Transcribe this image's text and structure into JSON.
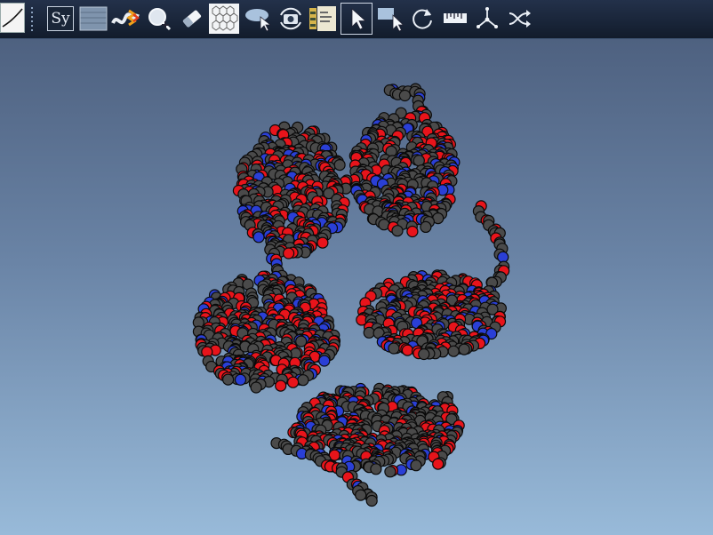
{
  "toolbar": {
    "symbol_button_label": "Sy",
    "tools": [
      {
        "name": "thumbnail-icon"
      },
      {
        "name": "symbol-button"
      },
      {
        "name": "surface-icon"
      },
      {
        "name": "ribbon-icon"
      },
      {
        "name": "zoom-in-icon"
      },
      {
        "name": "eraser-icon"
      },
      {
        "name": "hexagon-grid-icon"
      },
      {
        "name": "cloud-select-icon"
      },
      {
        "name": "camera-rotate-icon"
      },
      {
        "name": "documents-icon"
      },
      {
        "name": "select-arrow-icon"
      },
      {
        "name": "rect-select-icon"
      },
      {
        "name": "rotate-icon"
      },
      {
        "name": "ruler-icon"
      },
      {
        "name": "axes-icon"
      },
      {
        "name": "swap-icon"
      }
    ],
    "active_tool": "select-arrow-icon"
  },
  "viewport": {
    "background_top": "#4e6180",
    "background_bottom": "#98bad9"
  },
  "atom_colors": {
    "carbon": "#4a4a4a",
    "oxygen": "#e8141b",
    "nitrogen": "#2a3fd6",
    "outline": "#0a0a0a"
  }
}
